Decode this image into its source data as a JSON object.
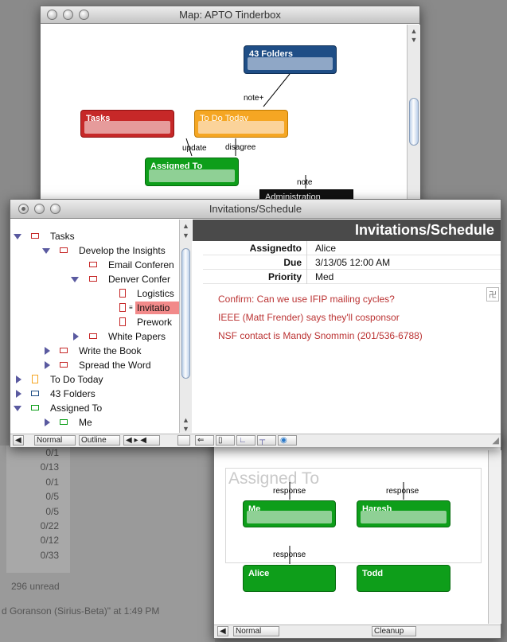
{
  "map_window": {
    "title": "Map: APTO Tinderbox",
    "notes": {
      "folders": "43 Folders",
      "tasks": "Tasks",
      "todo": "To Do Today",
      "assigned": "Assigned To",
      "admin": "Administration"
    },
    "links": {
      "note_plus": "note+",
      "note": "note",
      "update": "update",
      "disagree": "disagree"
    }
  },
  "bg_counts": [
    "0/1",
    "0/13",
    "0/1",
    "0/5",
    "0/5",
    "0/22",
    "0/12",
    "0/33"
  ],
  "bg_status": {
    "unread": "296 unread",
    "footer": "d Goranson (Sirius-Beta)\" at 1:49 PM"
  },
  "schedule_window": {
    "title": "Invitations/Schedule",
    "header": "Invitations/Schedule",
    "outline": [
      {
        "label": "Tasks"
      },
      {
        "label": "Develop the Insights"
      },
      {
        "label": "Email Conferen"
      },
      {
        "label": "Denver Confer"
      },
      {
        "label": "Logistics"
      },
      {
        "label": "Invitatio"
      },
      {
        "label": "Prework"
      },
      {
        "label": "White Papers"
      },
      {
        "label": "Write the Book"
      },
      {
        "label": "Spread the Word"
      },
      {
        "label": "To Do Today"
      },
      {
        "label": "43 Folders"
      },
      {
        "label": "Assigned To"
      },
      {
        "label": "Me"
      }
    ],
    "attributes": [
      {
        "key": "Assignedto",
        "value": "Alice"
      },
      {
        "key": "Due",
        "value": "3/13/05 12:00 AM"
      },
      {
        "key": "Priority",
        "value": "Med"
      }
    ],
    "text_lines": [
      "Confirm: Can we use IFIP mailing cycles?",
      "IEEE (Matt Frender) says they'll cosponsor",
      "NSF contact is Mandy Snommin (201/536-6788)"
    ],
    "bottom": {
      "normal": "Normal",
      "outline": "Outline"
    }
  },
  "assigned_window": {
    "title": "Assigned To",
    "notes": {
      "me": "Me",
      "haresh": "Haresh",
      "alice": "Alice",
      "todd": "Todd"
    },
    "link_label": "response",
    "bottom": {
      "normal": "Normal",
      "cleanup": "Cleanup"
    }
  },
  "colors": {
    "red_note": "#c62828",
    "orange_note": "#f5a623",
    "green_note": "#0e9e1a",
    "blue_note": "#1f4e86"
  }
}
